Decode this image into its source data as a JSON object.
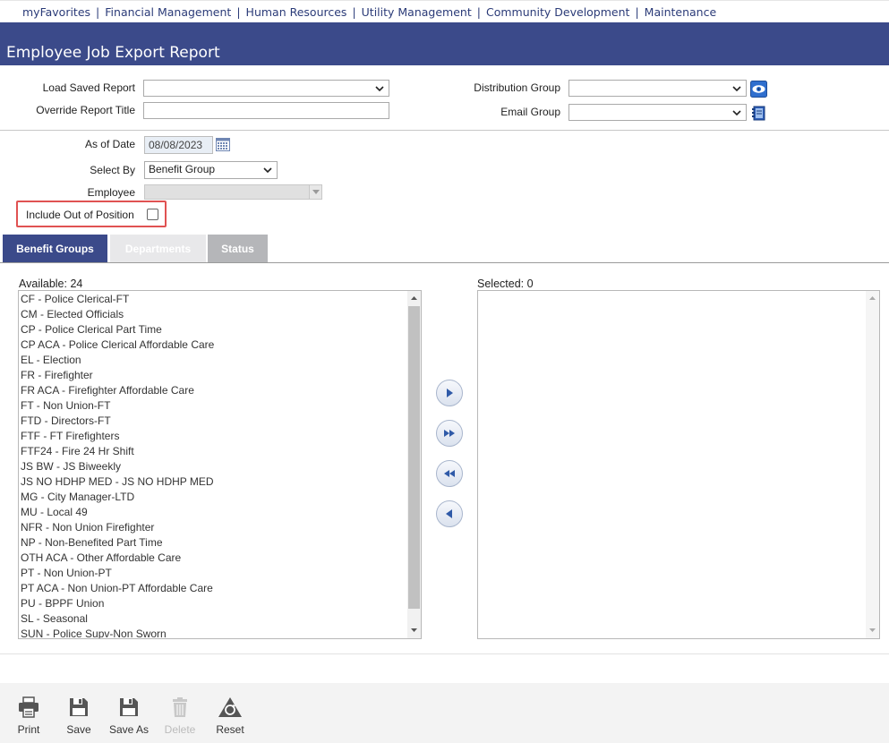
{
  "nav": {
    "items": [
      "myFavorites",
      "Financial Management",
      "Human Resources",
      "Utility Management",
      "Community Development",
      "Maintenance"
    ],
    "separator": "|"
  },
  "page": {
    "title": "Employee Job Export Report"
  },
  "form": {
    "load_saved_report_label": "Load Saved Report",
    "load_saved_report_value": "",
    "override_title_label": "Override Report Title",
    "override_title_value": "",
    "distribution_group_label": "Distribution Group",
    "distribution_group_value": "",
    "email_group_label": "Email Group",
    "email_group_value": "",
    "as_of_date_label": "As of Date",
    "as_of_date_value": "08/08/2023",
    "select_by_label": "Select By",
    "select_by_value": "Benefit Group",
    "employee_label": "Employee",
    "include_out_of_position_label": "Include Out of Position",
    "include_out_of_position_checked": false
  },
  "tabs": [
    {
      "label": "Benefit Groups",
      "state": "active"
    },
    {
      "label": "Departments",
      "state": "inactive"
    },
    {
      "label": "Status",
      "state": "inactive"
    }
  ],
  "available": {
    "label": "Available: 24",
    "items": [
      "CF - Police Clerical-FT",
      "CM - Elected Officials",
      "CP - Police Clerical Part Time",
      "CP ACA - Police Clerical Affordable Care",
      "EL - Election",
      "FR - Firefighter",
      "FR ACA - Firefighter Affordable Care",
      "FT - Non Union-FT",
      "FTD - Directors-FT",
      "FTF - FT Firefighters",
      "FTF24 - Fire 24 Hr Shift",
      "JS BW - JS Biweekly",
      "JS NO HDHP MED - JS NO HDHP MED",
      "MG - City Manager-LTD",
      "MU - Local 49",
      "NFR - Non Union Firefighter",
      "NP - Non-Benefited Part Time",
      "OTH ACA - Other Affordable Care",
      "PT - Non Union-PT",
      "PT ACA - Non Union-PT Affordable Care",
      "PU - BPPF Union",
      "SL - Seasonal",
      "SUN - Police Supv-Non Sworn"
    ]
  },
  "selected": {
    "label": "Selected: 0",
    "items": []
  },
  "toolbar": {
    "print": "Print",
    "save": "Save",
    "save_as": "Save As",
    "delete": "Delete",
    "reset": "Reset"
  },
  "colors": {
    "header_blue": "#3b4a8a",
    "nav_text": "#2b3b78",
    "highlight_red": "#e05252"
  }
}
